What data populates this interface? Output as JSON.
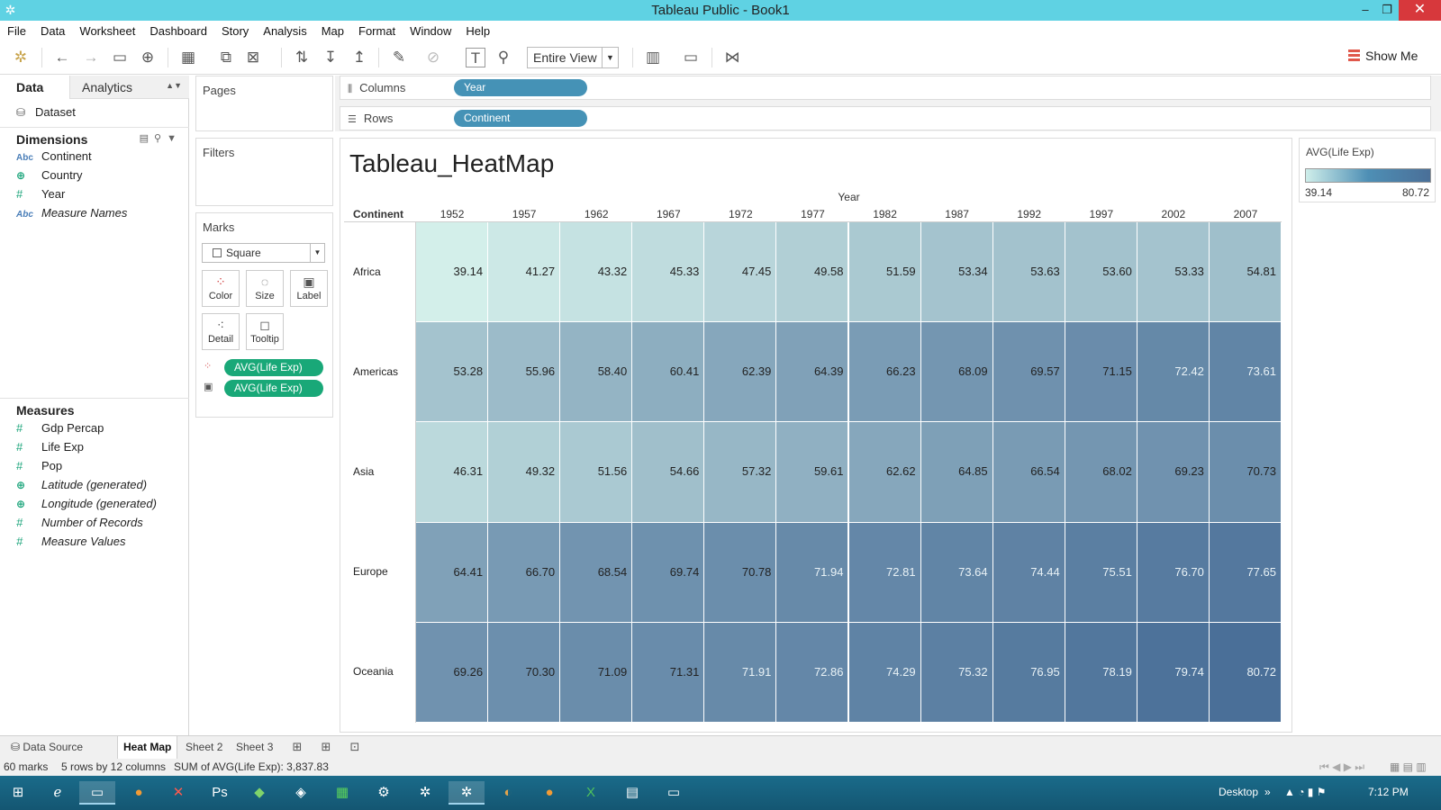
{
  "window": {
    "title": "Tableau Public - Book1",
    "min": "–",
    "restore": "❐",
    "close": "✕"
  },
  "menu": [
    "File",
    "Data",
    "Worksheet",
    "Dashboard",
    "Story",
    "Analysis",
    "Map",
    "Format",
    "Window",
    "Help"
  ],
  "toolbar": {
    "fit_select": "Entire View",
    "show_me": "Show Me"
  },
  "data_pane": {
    "tab_data": "Data",
    "tab_analytics": "Analytics",
    "dataset": "Dataset",
    "dimensions_title": "Dimensions",
    "dimensions": [
      {
        "icon": "Abc",
        "label": "Continent",
        "italic": false
      },
      {
        "icon": "globe",
        "label": "Country",
        "italic": false
      },
      {
        "icon": "#",
        "label": "Year",
        "italic": false
      },
      {
        "icon": "Abc",
        "label": "Measure Names",
        "italic": true
      }
    ],
    "measures_title": "Measures",
    "measures": [
      {
        "icon": "#",
        "label": "Gdp Percap",
        "italic": false
      },
      {
        "icon": "#",
        "label": "Life Exp",
        "italic": false
      },
      {
        "icon": "#",
        "label": "Pop",
        "italic": false
      },
      {
        "icon": "globe",
        "label": "Latitude (generated)",
        "italic": true
      },
      {
        "icon": "globe",
        "label": "Longitude (generated)",
        "italic": true
      },
      {
        "icon": "#",
        "label": "Number of Records",
        "italic": true
      },
      {
        "icon": "#",
        "label": "Measure Values",
        "italic": true
      }
    ]
  },
  "cards": {
    "pages": "Pages",
    "filters": "Filters",
    "marks": "Marks",
    "mark_type": "Square",
    "mark_buttons": [
      "Color",
      "Size",
      "Label",
      "Detail",
      "Tooltip"
    ],
    "mark_pills": [
      "AVG(Life Exp)",
      "AVG(Life Exp)"
    ]
  },
  "shelves": {
    "columns_label": "Columns",
    "columns_pill": "Year",
    "rows_label": "Rows",
    "rows_pill": "Continent"
  },
  "legend": {
    "title": "AVG(Life Exp)",
    "min_label": "39.14",
    "max_label": "80.72"
  },
  "chart_data": {
    "type": "heatmap",
    "title": "Tableau_HeatMap",
    "xlabel": "Year",
    "ylabel": "Continent",
    "x": [
      "1952",
      "1957",
      "1962",
      "1967",
      "1972",
      "1977",
      "1982",
      "1987",
      "1992",
      "1997",
      "2002",
      "2007"
    ],
    "y": [
      "Africa",
      "Americas",
      "Asia",
      "Europe",
      "Oceania"
    ],
    "values": [
      [
        39.14,
        41.27,
        43.32,
        45.33,
        47.45,
        49.58,
        51.59,
        53.34,
        53.63,
        53.6,
        53.33,
        54.81
      ],
      [
        53.28,
        55.96,
        58.4,
        60.41,
        62.39,
        64.39,
        66.23,
        68.09,
        69.57,
        71.15,
        72.42,
        73.61
      ],
      [
        46.31,
        49.32,
        51.56,
        54.66,
        57.32,
        59.61,
        62.62,
        64.85,
        66.54,
        68.02,
        69.23,
        70.73
      ],
      [
        64.41,
        66.7,
        68.54,
        69.74,
        70.78,
        71.94,
        72.81,
        73.64,
        74.44,
        75.51,
        76.7,
        77.65
      ],
      [
        69.26,
        70.3,
        71.09,
        71.31,
        71.91,
        72.86,
        74.29,
        75.32,
        76.95,
        78.19,
        79.74,
        80.72
      ]
    ],
    "color_range": [
      39.14,
      80.72
    ],
    "color_low": "#d3efea",
    "color_high": "#4a6f98"
  },
  "sheets": {
    "data_source": "Data Source",
    "tabs": [
      "Heat Map",
      "Sheet 2",
      "Sheet 3"
    ],
    "active": "Heat Map"
  },
  "status": {
    "marks": "60 marks",
    "dims": "5 rows by 12 columns",
    "sum": "SUM of AVG(Life Exp): 3,837.83"
  },
  "taskbar": {
    "desktop": "Desktop",
    "time": "7:12 PM"
  },
  "colors": {
    "titlebar": "#5fd2e3",
    "pill_green": "#19a878",
    "pill_blue": "#4592b6",
    "taskbar": "#145672"
  }
}
